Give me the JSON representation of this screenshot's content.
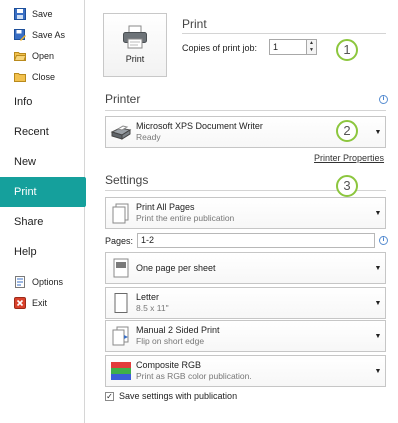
{
  "sidebar": {
    "small_top": [
      {
        "label": "Save",
        "icon": "save-icon"
      },
      {
        "label": "Save As",
        "icon": "save-as-icon"
      },
      {
        "label": "Open",
        "icon": "open-folder-icon"
      },
      {
        "label": "Close",
        "icon": "close-document-icon"
      }
    ],
    "big": [
      {
        "label": "Info"
      },
      {
        "label": "Recent"
      },
      {
        "label": "New"
      },
      {
        "label": "Print"
      },
      {
        "label": "Share"
      },
      {
        "label": "Help"
      }
    ],
    "small_bottom": [
      {
        "label": "Options",
        "icon": "options-icon"
      },
      {
        "label": "Exit",
        "icon": "exit-icon"
      }
    ],
    "active_color": "#15a09c"
  },
  "print": {
    "title": "Print",
    "button_label": "Print",
    "copies_label": "Copies of print job:",
    "copies_value": "1",
    "callout_1": "1",
    "callout_2": "2",
    "callout_3": "3"
  },
  "printer": {
    "title": "Printer",
    "name": "Microsoft XPS Document Writer",
    "status": "Ready",
    "properties_link": "Printer Properties"
  },
  "settings": {
    "title": "Settings",
    "range_main": "Print All Pages",
    "range_sub": "Print the entire publication",
    "pages_label": "Pages:",
    "pages_value": "1-2",
    "layout_main": "One page per sheet",
    "paper_main": "Letter",
    "paper_sub": "8.5 x 11\"",
    "duplex_main": "Manual 2 Sided Print",
    "duplex_sub": "Flip on short edge",
    "color_main": "Composite RGB",
    "color_sub": "Print as RGB color publication.",
    "save_settings_label": "Save settings with publication",
    "save_settings_checked": true
  }
}
